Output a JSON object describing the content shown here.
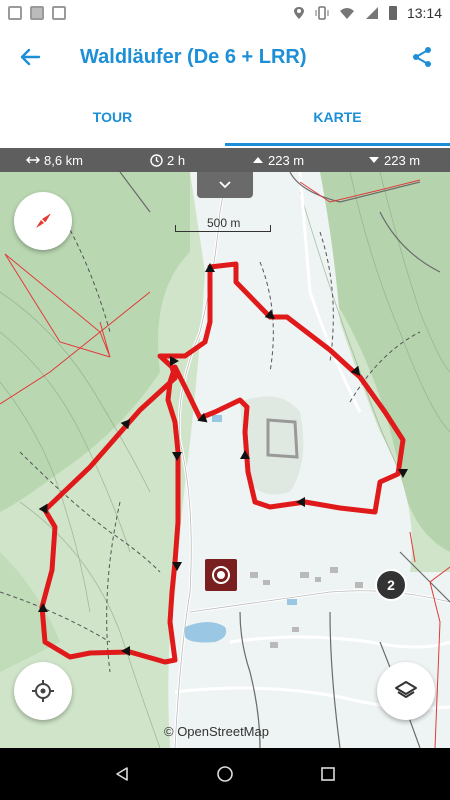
{
  "status_bar": {
    "time": "13:14",
    "icons": [
      "gmail-icon",
      "image-icon",
      "download-icon",
      "location-icon",
      "vibrate-icon",
      "wifi-icon",
      "signal-icon",
      "battery-icon"
    ]
  },
  "app_bar": {
    "title": "Waldläufer (De 6 + LRR)",
    "back_icon": "arrow-left-icon",
    "share_icon": "share-icon",
    "accent_color": "#1d8fd6"
  },
  "tabs": [
    {
      "label": "TOUR",
      "active": false
    },
    {
      "label": "KARTE",
      "active": true
    }
  ],
  "stats": {
    "distance": "8,6 km",
    "duration": "2 h",
    "ascent": "223 m",
    "descent": "223 m"
  },
  "map": {
    "scale_label": "500 m",
    "attribution": "© OpenStreetMap",
    "waypoint_label": "2",
    "route_color": "#e01a1a",
    "destination_color": "#7a1f1f"
  },
  "nav": {
    "back_icon": "nav-back-icon",
    "home_icon": "nav-home-icon",
    "recents_icon": "nav-recents-icon"
  }
}
